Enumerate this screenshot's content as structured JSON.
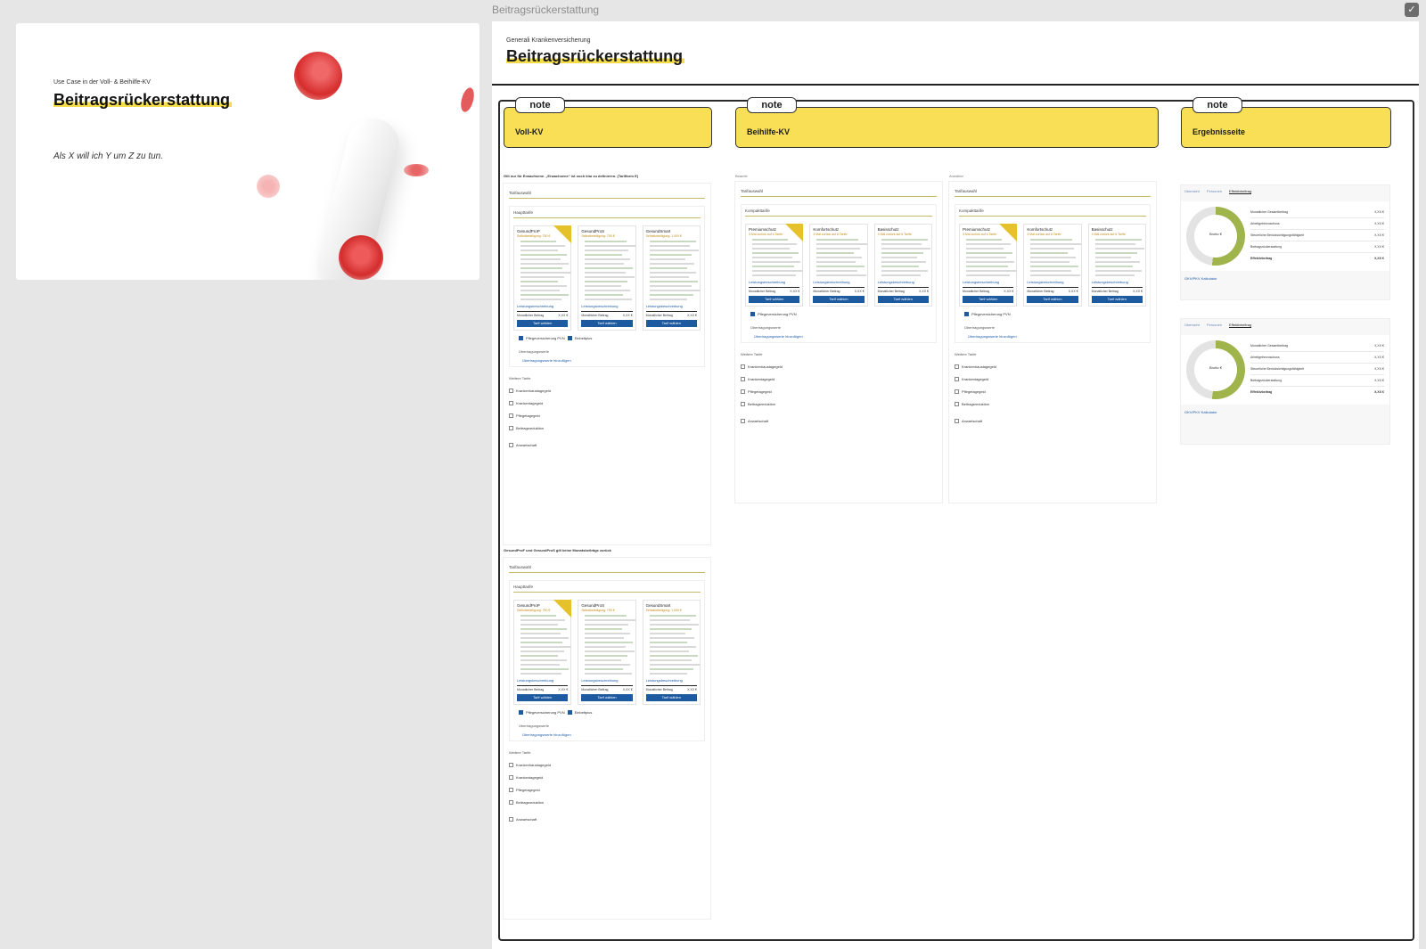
{
  "window": {
    "title": "Beitragsrückerstattung"
  },
  "cover": {
    "kicker": "Use Case in der Voll- & Beihilfe-KV",
    "title": "Beitragsrückerstattung",
    "subtitle": "Als X will ich Y um Z zu tun."
  },
  "board": {
    "kicker": "Generali Krankenversicherung",
    "title": "Beitragsrückerstattung"
  },
  "notes": [
    {
      "tab": "note",
      "label": "Voll-KV"
    },
    {
      "tab": "note",
      "label": "Beihilfe-KV"
    },
    {
      "tab": "note",
      "label": "Ergebnisseite"
    }
  ],
  "captions": {
    "voll_top": "Gilt nur für Erwachsene. „Erwachsene“ ist noch klar zu definieren. (Tarifform E)",
    "voll_bottom": "GesundProF und GesundProS gilt keine Monatsbeiträge zurück",
    "beihilfe_left": "Beamte",
    "beihilfe_right": "Anwärter"
  },
  "screen": {
    "tab_label": "Tarifauswahl",
    "main_voll": "Haupttarife",
    "main_beihilfe": "Kompakttarife",
    "voll_tariffs": [
      {
        "name": "GesundProP",
        "sub": "Selbstbeteiligung: 750 €"
      },
      {
        "name": "GesundProS",
        "sub": "Selbstbeteiligung: 750 €"
      },
      {
        "name": "GesundSmart",
        "sub": "Selbstbeteiligung: 1.000 €"
      }
    ],
    "beihilfe_tariffs": [
      {
        "name": "Premiumschutz",
        "sub": "3 Mal zurück auf 6 Tarife"
      },
      {
        "name": "Komfortschutz",
        "sub": "3 Mal zurück auf 6 Tarife"
      },
      {
        "name": "Basisschutz",
        "sub": "3 Mal zurück auf 6 Tarife"
      }
    ],
    "link": "Leistungsbeschreibung",
    "price_label": "Monatlicher Beitrag",
    "price_value": "X,XX €",
    "button": "Tarif wählen",
    "pv_label": "Pflegeversicherung PVN",
    "einbett_label": "Einbettplus",
    "ueber_label": "Übertragungswerte",
    "ueber_link": "Übertragungswerte hinzufügen",
    "weitere_label": "Weitere Tarife",
    "weitere": [
      "Krankenhaustagegeld",
      "Krankentagegeld",
      "Pflegetagegeld",
      "Beitragsreduktion",
      "Anwartschaft"
    ]
  },
  "results": {
    "tabs": [
      "Übersicht",
      "Personen",
      "Effektivbeitrag"
    ],
    "donut_label": "Brutto €",
    "lines": [
      {
        "label": "Monatlicher Gesamtbeitrag",
        "value": "X,XX €"
      },
      {
        "label": "Arbeitgeberzuschuss",
        "value": "X,XX €"
      },
      {
        "label": "Steuerliche Berücksichtigungsfähigkeit",
        "value": "X,XX €"
      },
      {
        "label": "Beitragsrückerstattung",
        "value": "X,XX €"
      }
    ],
    "total_label": "Effektivbeitrag",
    "total_value": "X,XX €",
    "link": "GKV/PKV Kalkulator"
  }
}
